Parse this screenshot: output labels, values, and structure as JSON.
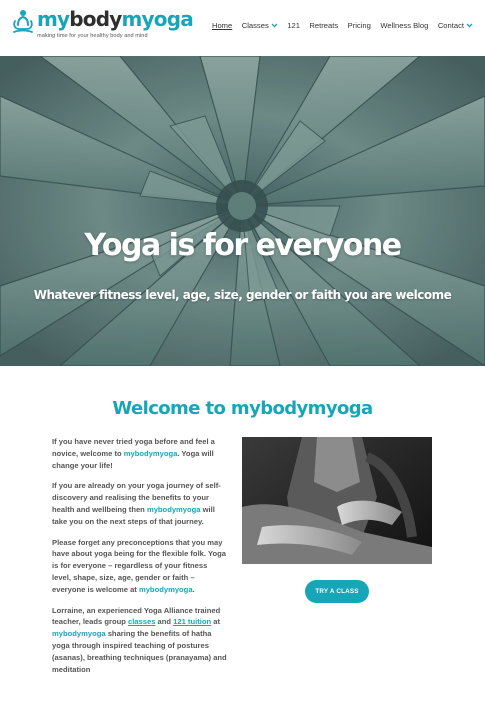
{
  "header": {
    "logo_prefix": "my",
    "logo_dark": "body",
    "logo_suffix": "myoga",
    "tagline": "making time for your healthy body and mind",
    "nav": [
      {
        "label": "Home",
        "active": true,
        "dropdown": false
      },
      {
        "label": "Classes",
        "active": false,
        "dropdown": true
      },
      {
        "label": "121",
        "active": false,
        "dropdown": false
      },
      {
        "label": "Retreats",
        "active": false,
        "dropdown": false
      },
      {
        "label": "Pricing",
        "active": false,
        "dropdown": false
      },
      {
        "label": "Wellness Blog",
        "active": false,
        "dropdown": false
      },
      {
        "label": "Contact",
        "active": false,
        "dropdown": true
      }
    ]
  },
  "hero": {
    "title": "Yoga is for everyone",
    "subtitle": "Whatever fitness level, age, size, gender or faith you are welcome"
  },
  "welcome": {
    "title": "Welcome to mybodymyoga",
    "p1": {
      "a": "If you have never tried yoga before and feel a novice, welcome to ",
      "hl": "mybodymyoga",
      "b": ". Yoga will change your life!"
    },
    "p2": {
      "a": "If you are already on your yoga journey of self-discovery and realising the benefits to your health and wellbeing then ",
      "hl": "mybodymyoga",
      "b": " will take you on the next steps of that journey."
    },
    "p3": {
      "a": "Please forget any preconceptions that you may have about yoga being for the flexible folk.  Yoga is for everyone – regardless of your fitness level, shape, size, age, gender or faith – everyone is welcome at ",
      "hl": "mybodymyoga",
      "b": "."
    },
    "p4": {
      "a": "Lorraine, an experienced Yoga Alliance trained teacher, leads group ",
      "link1": "classes",
      "b": " and ",
      "link2": "121 tuition",
      "c": " at ",
      "hl": "mybodymyoga",
      "d": " sharing the benefits of hatha yoga through inspired teaching of postures (asanas), breathing techniques (pranayama) and meditation"
    },
    "button": "TRY A CLASS"
  },
  "colors": {
    "accent": "#17a6b8",
    "text": "#555555",
    "dark": "#2e2e2e"
  }
}
